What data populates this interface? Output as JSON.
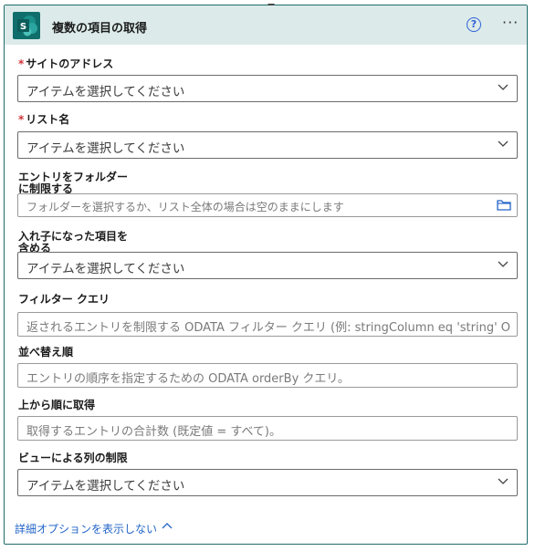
{
  "header": {
    "title": "複数の項目の取得",
    "help_symbol": "?",
    "more_symbol": "···"
  },
  "fields": [
    {
      "label": "サイトのアドレス",
      "required": true,
      "value": "アイテムを選択してください",
      "kind": "select"
    },
    {
      "label": "リスト名",
      "required": true,
      "value": "アイテムを選択してください",
      "kind": "select"
    },
    {
      "label_line1": "エントリをフォルダー",
      "label_line2": "に制限する",
      "placeholder": "フォルダーを選択するか、リスト全体の場合は空のままにします",
      "kind": "folder"
    },
    {
      "label_line1": "入れ子になった項目を",
      "label_line2": "含める",
      "value": "アイテムを選択してください",
      "kind": "select"
    },
    {
      "label": "フィルター クエリ",
      "placeholder": "返されるエントリを制限する ODATA フィルター クエリ (例: stringColumn eq 'string' OR",
      "kind": "text"
    },
    {
      "label": "並べ替え順",
      "placeholder": "エントリの順序を指定するための ODATA orderBy クエリ。",
      "kind": "text"
    },
    {
      "label": "上から順に取得",
      "placeholder": "取得するエントリの合計数 (既定値 = すべて)。",
      "kind": "text"
    },
    {
      "label": "ビューによる列の制限",
      "value": "アイテムを選択してください",
      "kind": "select"
    }
  ],
  "required_marker": "*",
  "advanced_link": "詳細オプションを表示しない",
  "colors": {
    "header_bg": "#dcebea",
    "icon_bg": "#0f6e6b",
    "link": "#2365c8",
    "required": "#d13438"
  },
  "icons": {
    "app": "sharepoint-icon",
    "help": "help-icon",
    "more": "more-options-icon",
    "dropdown": "chevron-down-icon",
    "folder": "folder-icon",
    "collapse": "chevron-up-icon"
  }
}
